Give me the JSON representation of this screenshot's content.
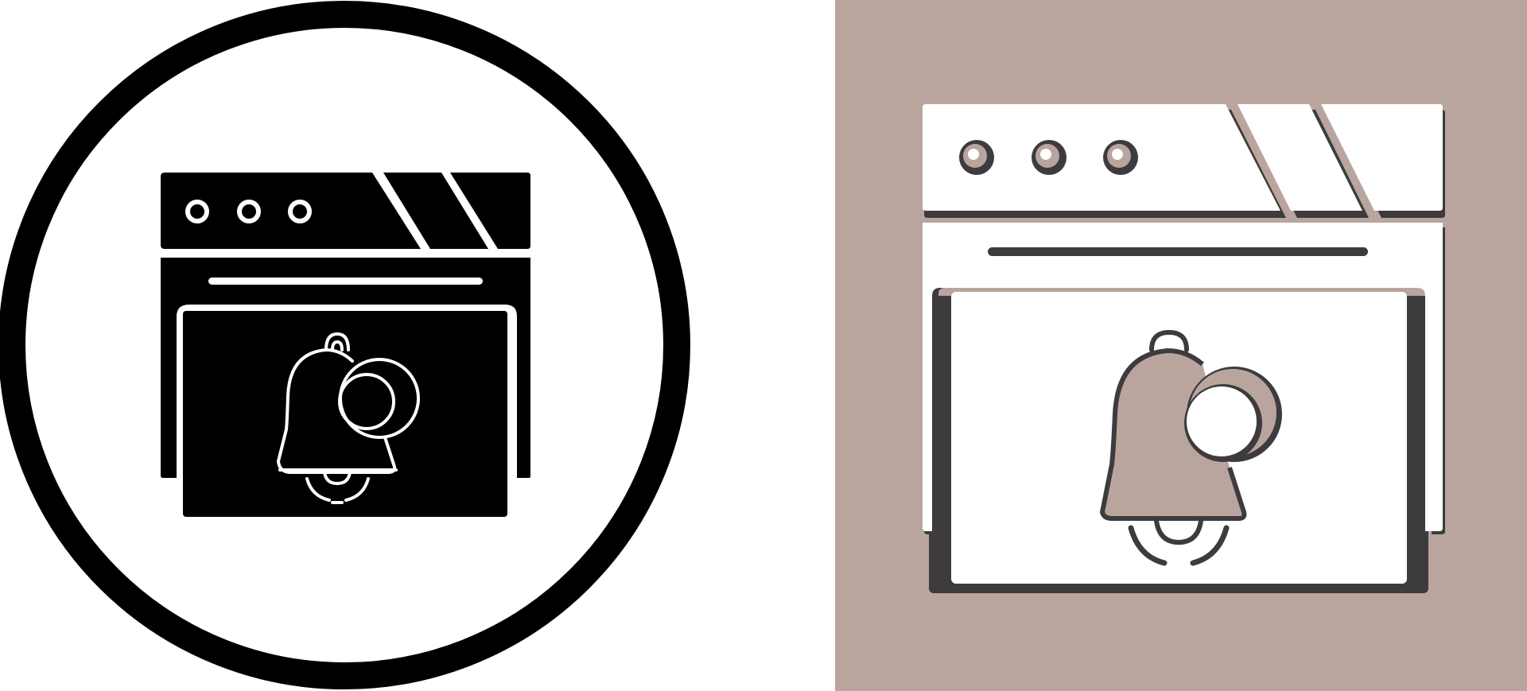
{
  "palette": {
    "ink": "#000000",
    "paper": "#ffffff",
    "taupe_background": "#b9a59e",
    "shadow": "#3d3b3e"
  },
  "icons": [
    {
      "name": "browser-notification-bell-icon",
      "style": "glyph",
      "background": "circle-outline"
    },
    {
      "name": "browser-notification-bell-icon",
      "style": "flat-with-shadow",
      "background": "taupe-square"
    }
  ]
}
